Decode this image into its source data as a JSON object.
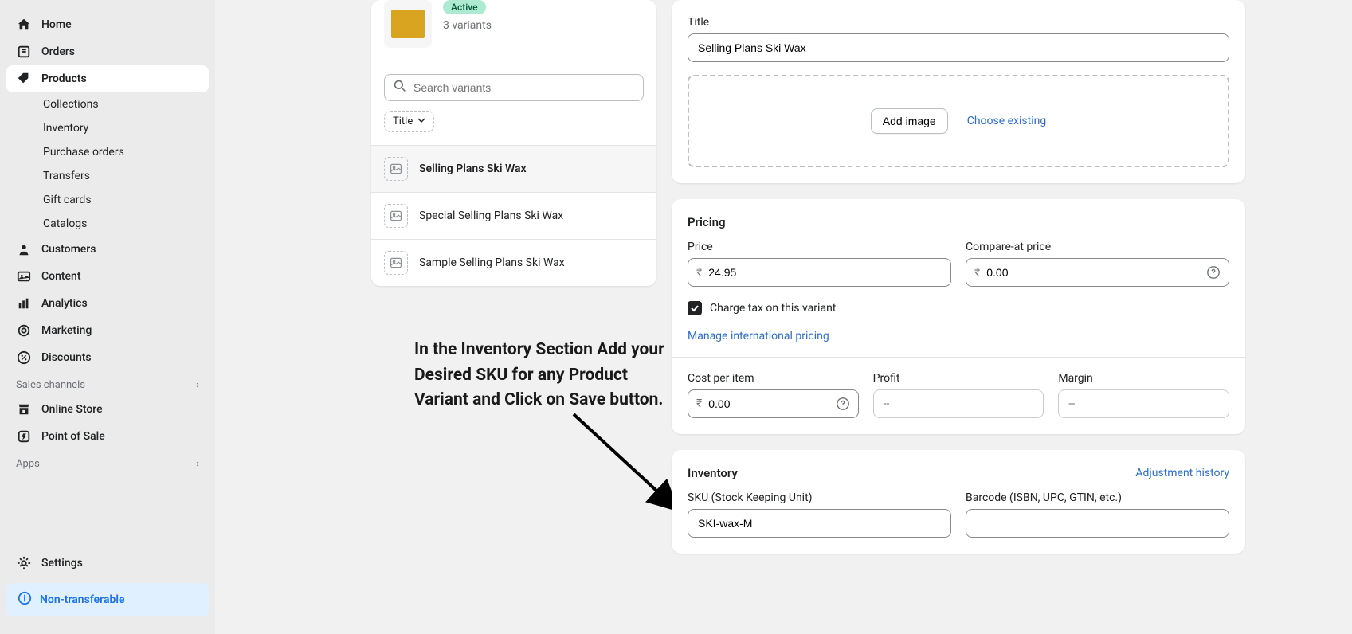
{
  "sidebar": {
    "home": "Home",
    "orders": "Orders",
    "products": "Products",
    "collections": "Collections",
    "inventory": "Inventory",
    "purchase_orders": "Purchase orders",
    "transfers": "Transfers",
    "gift_cards": "Gift cards",
    "catalogs": "Catalogs",
    "customers": "Customers",
    "content": "Content",
    "analytics": "Analytics",
    "marketing": "Marketing",
    "discounts": "Discounts",
    "sales_channels_label": "Sales channels",
    "online_store": "Online Store",
    "point_of_sale": "Point of Sale",
    "apps_label": "Apps",
    "settings": "Settings",
    "non_transferable": "Non-transferable"
  },
  "product": {
    "status": "Active",
    "variant_count": "3 variants",
    "search_placeholder": "Search variants",
    "filter_chip": "Title",
    "variants": [
      "Selling Plans Ski Wax",
      "Special Selling Plans Ski Wax",
      "Sample Selling Plans Ski Wax"
    ]
  },
  "annotation": "In the Inventory Section Add your Desired SKU for any Product Variant and Click on Save button.",
  "form": {
    "title_label": "Title",
    "title_value": "Selling Plans Ski Wax",
    "add_image": "Add image",
    "choose_existing": "Choose existing",
    "pricing_title": "Pricing",
    "price_label": "Price",
    "price_value": "24.95",
    "compare_label": "Compare-at price",
    "compare_value": "0.00",
    "currency": "₹",
    "charge_tax": "Charge tax on this variant",
    "manage_intl": "Manage international pricing",
    "cost_label": "Cost per item",
    "cost_value": "0.00",
    "profit_label": "Profit",
    "profit_value": "--",
    "margin_label": "Margin",
    "margin_value": "--",
    "inventory_title": "Inventory",
    "adjustment_history": "Adjustment history",
    "sku_label": "SKU (Stock Keeping Unit)",
    "sku_value": "SKI-wax-M",
    "barcode_label": "Barcode (ISBN, UPC, GTIN, etc.)",
    "barcode_value": ""
  }
}
